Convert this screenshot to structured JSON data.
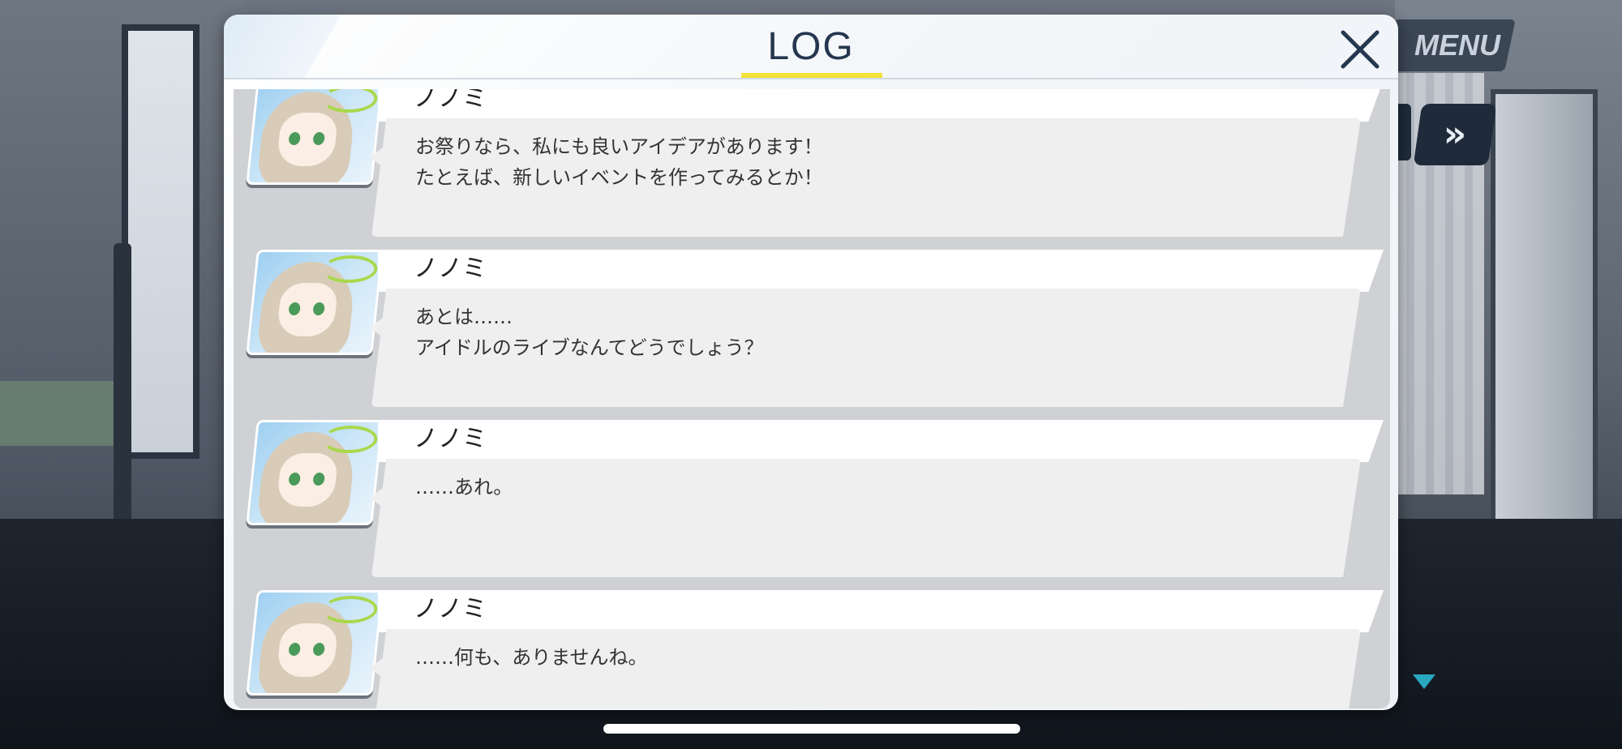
{
  "hud": {
    "menu_label": "MENU",
    "fast_forward_label": "»"
  },
  "log_panel": {
    "title": "LOG",
    "close_label": "×",
    "entries": [
      {
        "speaker": "ノノミ",
        "line1": "お祭りなら、私にも良いアイデアがあります！",
        "line2": "たとえば、新しいイベントを作ってみるとか！"
      },
      {
        "speaker": "ノノミ",
        "line1": "あとは……",
        "line2": "アイドルのライブなんてどうでしょう？"
      },
      {
        "speaker": "ノノミ",
        "line1": "……あれ。",
        "line2": ""
      },
      {
        "speaker": "ノノミ",
        "line1": "……何も、ありませんね。",
        "line2": ""
      }
    ]
  },
  "colors": {
    "title_underline": "#f2e23a",
    "title_text": "#25374f",
    "scroll_indicator": "#2aa7c0"
  }
}
